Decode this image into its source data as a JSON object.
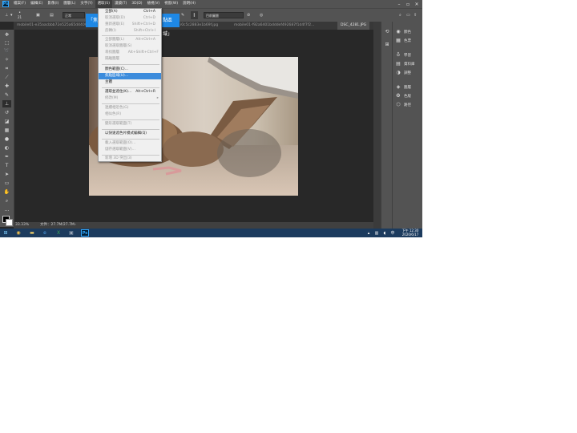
{
  "menubar": {
    "items": [
      "檔案(F)",
      "編輯(E)",
      "影像(I)",
      "圖層(L)",
      "文字(Y)",
      "選取(S)",
      "濾鏡(T)",
      "3D(D)",
      "檢視(V)",
      "視窗(W)",
      "說明(H)"
    ]
  },
  "options": {
    "brush_size": "21",
    "mode_value": "正常",
    "sample_value": "目前圖層"
  },
  "tabs": [
    "mobile01-e35aacbbb72e525a65d4409...",
    "...6c25d2f8ec...",
    "i0c5c2883e1b69f.jpg",
    "mobile01-f92a6401bdddef492687f1d4f7f2... ",
    "DSC_4281.JPG"
  ],
  "select_menu": {
    "items": [
      {
        "label": "全部(A)",
        "shortcut": "Ctrl+A",
        "disabled": false
      },
      {
        "label": "取消選取(D)",
        "shortcut": "Ctrl+D",
        "disabled": true
      },
      {
        "label": "重新選取(E)",
        "shortcut": "Shift+Ctrl+D",
        "disabled": true
      },
      {
        "label": "反轉(I)",
        "shortcut": "Shift+Ctrl+I",
        "disabled": true
      },
      {
        "label": "全部圖層(L)",
        "shortcut": "Alt+Ctrl+A",
        "disabled": true
      },
      {
        "label": "取消選取圖層(S)",
        "shortcut": "",
        "disabled": true
      },
      {
        "label": "尋找圖層",
        "shortcut": "Alt+Shift+Ctrl+F",
        "disabled": true
      },
      {
        "label": "隔離圖層",
        "shortcut": "",
        "disabled": true
      },
      {
        "label": "顏色範圍(C)...",
        "shortcut": "",
        "disabled": false
      },
      {
        "label": "焦點區域(U)...",
        "shortcut": "",
        "disabled": false,
        "highlighted": true
      },
      {
        "label": "主體",
        "shortcut": "",
        "disabled": false
      },
      {
        "label": "選取並遮住(K)...",
        "shortcut": "Alt+Ctrl+R",
        "disabled": false
      },
      {
        "label": "修改(M)",
        "shortcut": "",
        "disabled": true,
        "submenu": true
      },
      {
        "label": "連續相近色(G)",
        "shortcut": "",
        "disabled": true
      },
      {
        "label": "相似色(R)",
        "shortcut": "",
        "disabled": true
      },
      {
        "label": "變形選取範圍(T)",
        "shortcut": "",
        "disabled": true
      },
      {
        "label": "以快速遮色片模式編輯(Q)",
        "shortcut": "",
        "disabled": false
      },
      {
        "label": "載入選取範圍(O)...",
        "shortcut": "",
        "disabled": true
      },
      {
        "label": "儲存選取範圍(V)...",
        "shortcut": "",
        "disabled": true
      },
      {
        "label": "新增 3D 突出(3)",
        "shortcut": "",
        "disabled": true
      }
    ]
  },
  "tooltip": {
    "left": "「焦",
    "right": "點區域」"
  },
  "status": {
    "zoom": "33.33%",
    "doc": "文件：27.7M/27.7M"
  },
  "panels": [
    {
      "icon": "palette-icon",
      "label": "顏色"
    },
    {
      "icon": "swatches-icon",
      "label": "色票"
    },
    {
      "icon": "learn-icon",
      "label": "學習"
    },
    {
      "icon": "library-icon",
      "label": "資料庫"
    },
    {
      "icon": "adjust-icon",
      "label": "調整"
    },
    {
      "icon": "layers-icon",
      "label": "圖層"
    },
    {
      "icon": "channels-icon",
      "label": "色版"
    },
    {
      "icon": "paths-icon",
      "label": "路徑"
    }
  ],
  "taskbar": {
    "ps_label": "Ps",
    "time": "下午 12:30",
    "date": "2020/6/17"
  },
  "colors": {
    "ps_bg": "#535353",
    "canvas_bg": "#282828",
    "menu_highlight": "#3c8cdc",
    "tooltip_blue": "#1e88e5",
    "taskbar": "#1c3b5e"
  }
}
